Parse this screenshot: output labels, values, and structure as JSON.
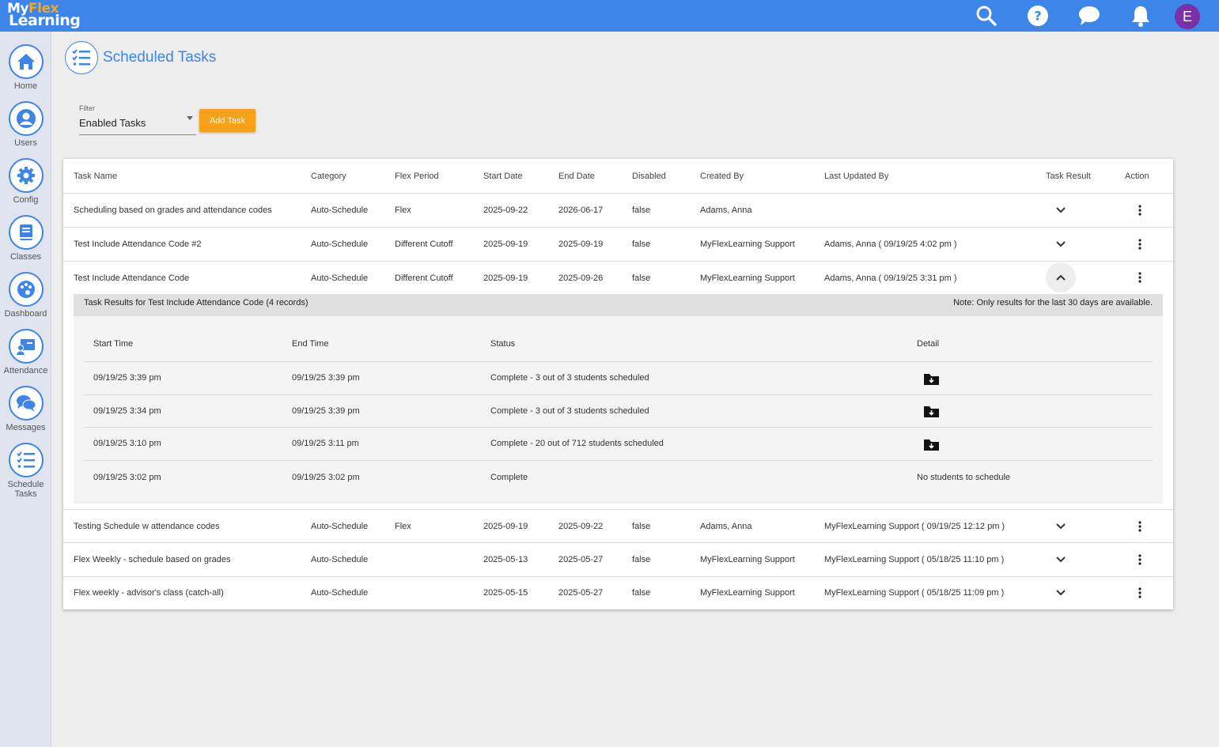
{
  "app": {
    "logo_line1_a": "My",
    "logo_line1_b": "Flex",
    "logo_line2": "Learning",
    "avatar_initial": "E",
    "accent": "#3d85e8",
    "orange": "#f7a11a"
  },
  "topbar_icons": [
    "search-icon",
    "help-icon",
    "chat-icon",
    "bell-icon"
  ],
  "sidebar": {
    "items": [
      {
        "label": "Home",
        "icon": "home-icon"
      },
      {
        "label": "Users",
        "icon": "user-icon"
      },
      {
        "label": "Config",
        "icon": "gear-icon"
      },
      {
        "label": "Classes",
        "icon": "book-icon"
      },
      {
        "label": "Dashboard",
        "icon": "palette-icon"
      },
      {
        "label": "Attendance",
        "icon": "presentation-icon"
      },
      {
        "label": "Messages",
        "icon": "messages-icon"
      },
      {
        "label": "Schedule",
        "label2": "Tasks",
        "icon": "checklist-icon"
      }
    ]
  },
  "page": {
    "title": "Scheduled Tasks",
    "filter_label": "Filter",
    "filter_value": "Enabled Tasks",
    "add_button": "Add Task"
  },
  "table": {
    "columns": [
      "Task Name",
      "Category",
      "Flex Period",
      "Start Date",
      "End Date",
      "Disabled",
      "Created By",
      "Last Updated By",
      "Task Result",
      "Action"
    ],
    "rows": [
      [
        "Scheduling based on grades and attendance codes",
        "Auto-Schedule",
        "Flex",
        "2025-09-22",
        "2026-06-17",
        "false",
        "Adams, Anna",
        ""
      ],
      [
        "Test Include Attendance Code #2",
        "Auto-Schedule",
        "Different Cutoff",
        "2025-09-19",
        "2025-09-19",
        "false",
        "MyFlexLearning Support",
        "Adams, Anna ( 09/19/25 4:02 pm )"
      ],
      [
        "Test Include Attendance Code",
        "Auto-Schedule",
        "Different Cutoff",
        "2025-09-19",
        "2025-09-26",
        "false",
        "MyFlexLearning Support",
        "Adams, Anna ( 09/19/25 3:31 pm )"
      ],
      [
        "Testing Schedule w attendance codes",
        "Auto-Schedule",
        "Flex",
        "2025-09-19",
        "2025-09-22",
        "false",
        "Adams, Anna",
        "MyFlexLearning Support ( 09/19/25 12:12 pm )"
      ],
      [
        "Flex Weekly - schedule based on grades",
        "Auto-Schedule",
        "",
        "2025-05-13",
        "2025-05-27",
        "false",
        "MyFlexLearning Support",
        "MyFlexLearning Support ( 05/18/25 11:10 pm )"
      ],
      [
        "Flex weekly - advisor's class (catch-all)",
        "Auto-Schedule",
        "",
        "2025-05-15",
        "2025-05-27",
        "false",
        "MyFlexLearning Support",
        "MyFlexLearning Support ( 05/18/25 11:09 pm )"
      ]
    ]
  },
  "results": {
    "title": "Task Results for Test Include Attendance Code (4 records)",
    "note": "Note: Only results for the last 30 days are available.",
    "columns": [
      "Start Time",
      "End Time",
      "Status",
      "Detail"
    ],
    "rows": [
      [
        "09/19/25 3:39 pm",
        "09/19/25 3:39 pm",
        "Complete - 3 out of 3 students scheduled",
        ""
      ],
      [
        "09/19/25 3:34 pm",
        "09/19/25 3:39 pm",
        "Complete - 3 out of 3 students scheduled",
        ""
      ],
      [
        "09/19/25 3:10 pm",
        "09/19/25 3:11 pm",
        "Complete - 20 out of 712 students scheduled",
        ""
      ],
      [
        "09/19/25 3:02 pm",
        "09/19/25 3:02 pm",
        "Complete",
        "No students to schedule"
      ]
    ]
  }
}
